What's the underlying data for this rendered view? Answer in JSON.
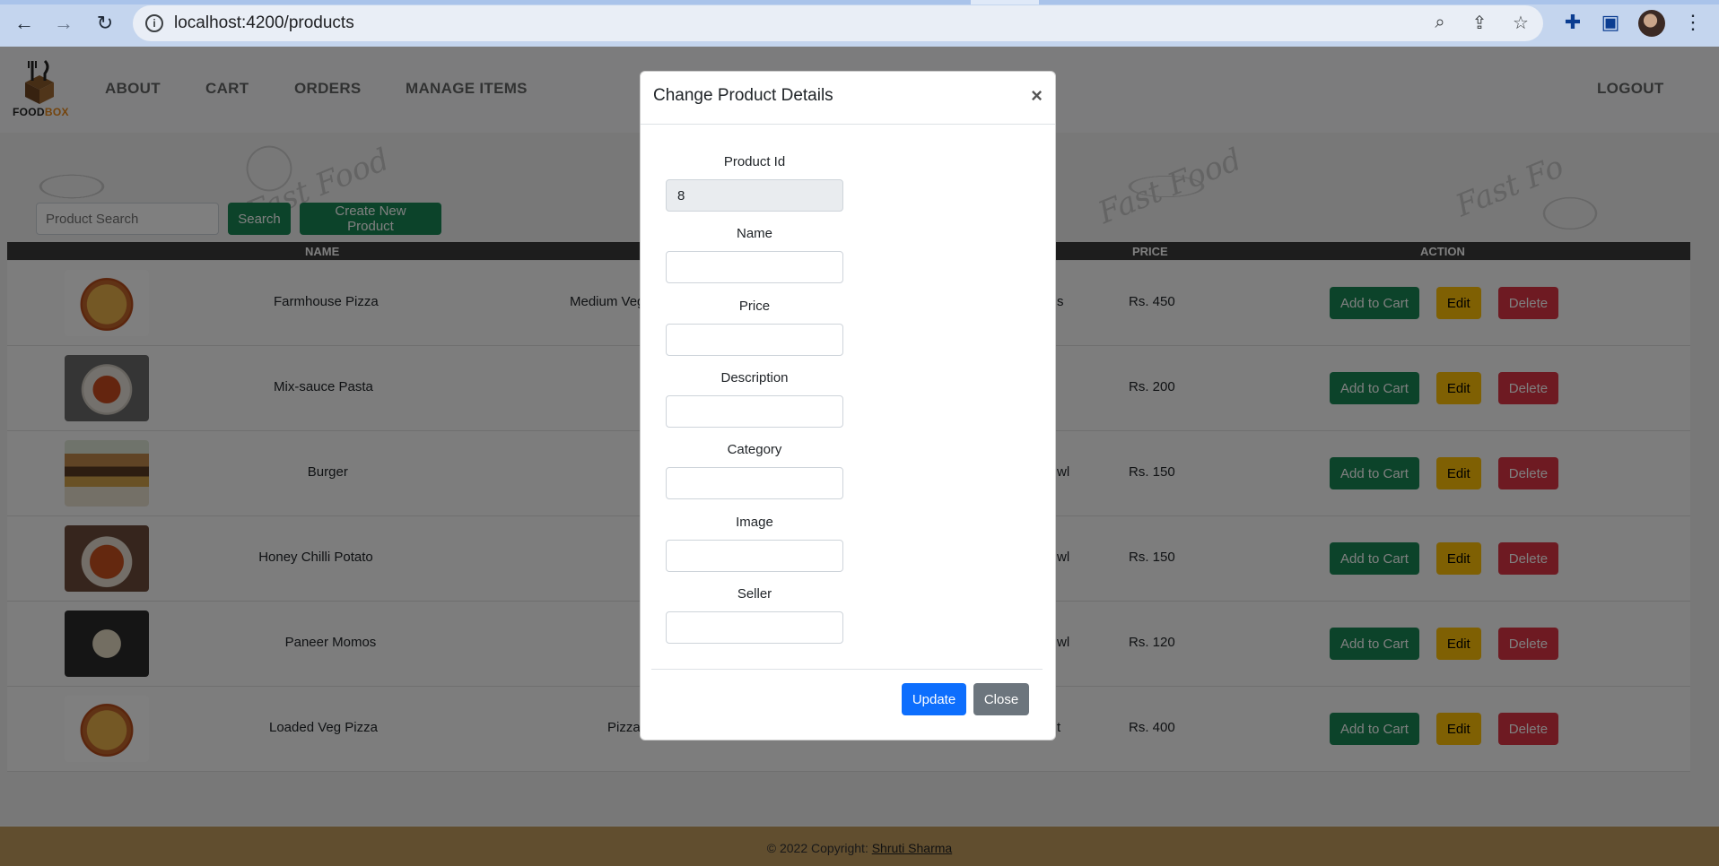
{
  "browser": {
    "url": "localhost:4200/products"
  },
  "app": {
    "logo_text_a": "FOOD",
    "logo_text_b": "BOX",
    "nav": [
      "ABOUT",
      "CART",
      "ORDERS",
      "MANAGE ITEMS"
    ],
    "logout": "LOGOUT",
    "search": {
      "placeholder": "Product Search",
      "button": "Search",
      "create_button": "Create New Product"
    },
    "table": {
      "headers": [
        "NAME",
        "PRICE",
        "ACTION"
      ],
      "rows": [
        {
          "name": "Farmhouse Pizza",
          "description": "Medium Veg",
          "category_fragment": "s",
          "price": "Rs. 450",
          "image": "pizza"
        },
        {
          "name": "Mix-sauce Pasta",
          "description": "",
          "category_fragment": "",
          "price": "Rs. 200",
          "image": "pasta"
        },
        {
          "name": "Burger",
          "description": "",
          "category_fragment": "wl",
          "price": "Rs. 150",
          "image": "burger"
        },
        {
          "name": "Honey Chilli Potato",
          "description": "",
          "category_fragment": "wl",
          "price": "Rs. 150",
          "image": "potato"
        },
        {
          "name": "Paneer Momos",
          "description": "",
          "category_fragment": "wl",
          "price": "Rs. 120",
          "image": "momos"
        },
        {
          "name": "Loaded Veg Pizza",
          "description": "Pizza",
          "category_fragment": "t",
          "price": "Rs. 400",
          "image": "pizza"
        }
      ],
      "actions": {
        "add": "Add to Cart",
        "edit": "Edit",
        "delete": "Delete"
      }
    },
    "footer": {
      "text": "© 2022 Copyright: ",
      "author": "Shruti Sharma"
    }
  },
  "modal": {
    "title": "Change Product Details",
    "close_glyph": "×",
    "fields": [
      {
        "label": "Product Id",
        "value": "8"
      },
      {
        "label": "Name",
        "value": ""
      },
      {
        "label": "Price",
        "value": ""
      },
      {
        "label": "Description",
        "value": ""
      },
      {
        "label": "Category",
        "value": ""
      },
      {
        "label": "Image",
        "value": ""
      },
      {
        "label": "Seller",
        "value": ""
      }
    ],
    "update_button": "Update",
    "close_button": "Close"
  },
  "colors": {
    "success": "#198754",
    "warning": "#ffc107",
    "danger": "#dc3545",
    "primary": "#0d6efd",
    "secondary": "#6c757d",
    "footer": "#c39c5f"
  },
  "icons": [
    "back-arrow-icon",
    "forward-arrow-icon",
    "reload-icon",
    "info-icon",
    "zoom-icon",
    "share-icon",
    "star-icon",
    "extensions-icon",
    "sidepanel-icon",
    "menu-dots-icon"
  ]
}
